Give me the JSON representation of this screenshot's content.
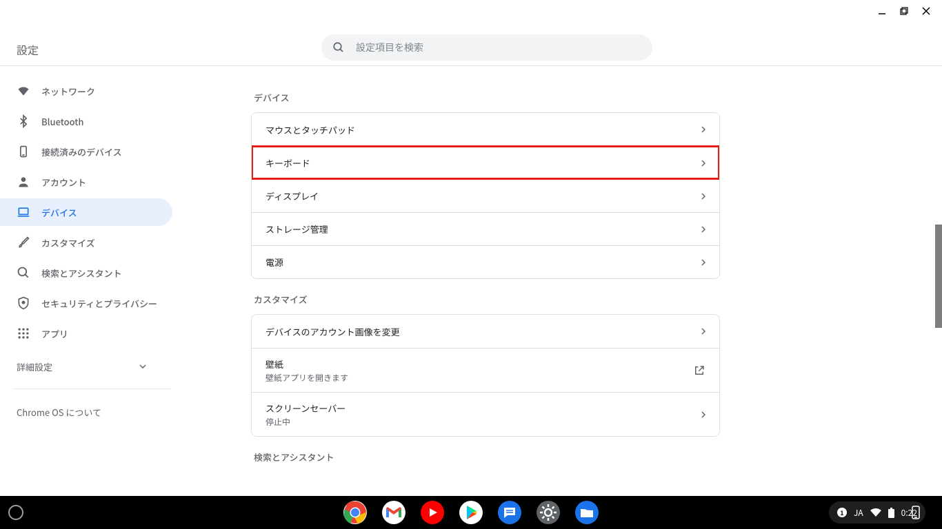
{
  "header": {
    "title": "設定",
    "search_placeholder": "設定項目を検索"
  },
  "sidebar": {
    "items": [
      {
        "icon": "wifi",
        "label": "ネットワーク"
      },
      {
        "icon": "bluetooth",
        "label": "Bluetooth"
      },
      {
        "icon": "devices",
        "label": "接続済みのデバイス"
      },
      {
        "icon": "person",
        "label": "アカウント"
      },
      {
        "icon": "laptop",
        "label": "デバイス",
        "active": true
      },
      {
        "icon": "brush",
        "label": "カスタマイズ"
      },
      {
        "icon": "search",
        "label": "検索とアシスタント"
      },
      {
        "icon": "shield",
        "label": "セキュリティとプライバシー"
      },
      {
        "icon": "apps",
        "label": "アプリ"
      }
    ],
    "advanced_label": "詳細設定",
    "about_label": "Chrome OS について"
  },
  "sections": [
    {
      "title": "デバイス",
      "rows": [
        {
          "label": "マウスとタッチパッド",
          "action": "chevron"
        },
        {
          "label": "キーボード",
          "action": "chevron",
          "highlighted": true
        },
        {
          "label": "ディスプレイ",
          "action": "chevron"
        },
        {
          "label": "ストレージ管理",
          "action": "chevron"
        },
        {
          "label": "電源",
          "action": "chevron"
        }
      ]
    },
    {
      "title": "カスタマイズ",
      "rows": [
        {
          "label": "デバイスのアカウント画像を変更",
          "action": "chevron"
        },
        {
          "label": "壁紙",
          "sub": "壁紙アプリを開きます",
          "action": "external"
        },
        {
          "label": "スクリーンセーバー",
          "sub": "停止中",
          "action": "chevron"
        }
      ]
    },
    {
      "title": "検索とアシスタント",
      "rows": []
    }
  ],
  "shelf": {
    "apps": [
      {
        "name": "chrome",
        "color1": "#ea4335",
        "color2": "#fbbc05",
        "color3": "#34a853",
        "color4": "#4285f4"
      },
      {
        "name": "gmail",
        "bg": "#fff"
      },
      {
        "name": "youtube",
        "bg": "#ff0000"
      },
      {
        "name": "play",
        "bg": "#fff"
      },
      {
        "name": "messages",
        "bg": "#1a73e8"
      },
      {
        "name": "settings",
        "bg": "#5f6368"
      },
      {
        "name": "files",
        "bg": "#1a73e8"
      }
    ],
    "status": {
      "ime_count": "1",
      "ime_lang": "JA",
      "time": "0:22"
    }
  }
}
